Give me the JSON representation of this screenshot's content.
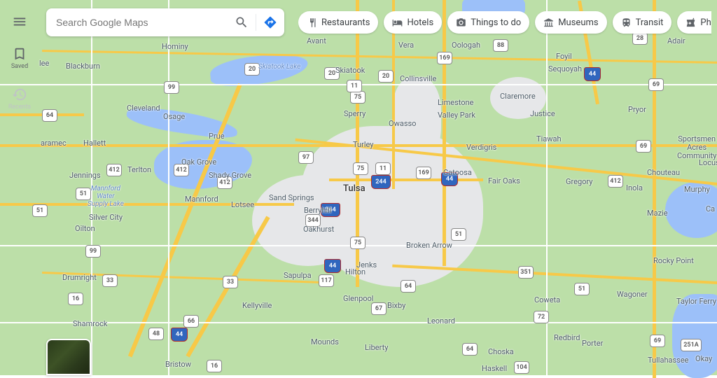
{
  "search": {
    "placeholder": "Search Google Maps"
  },
  "sidebar": {
    "saved": "Saved",
    "recents": "Recents"
  },
  "chips": [
    {
      "label": "Restaurants"
    },
    {
      "label": "Hotels"
    },
    {
      "label": "Things to do"
    },
    {
      "label": "Museums"
    },
    {
      "label": "Transit"
    },
    {
      "label": "Pharmacies"
    }
  ],
  "cities": {
    "tulsa": "Tulsa",
    "sand_springs": "Sand Springs",
    "owasso": "Owasso",
    "broken_arrow": "Broken Arrow",
    "jenks": "Jenks",
    "bixby": "Bixby",
    "sapulpa": "Sapulpa",
    "glenpool": "Glenpool",
    "claremore": "Claremore",
    "collinsville": "Collinsville",
    "skiatook": "Skiatook",
    "coweta": "Coweta",
    "catoosa": "Catoosa",
    "sperry": "Sperry",
    "turley": "Turley",
    "verdigris": "Verdigris",
    "pryor": "Pryor",
    "wagoner": "Wagoner",
    "inola": "Inola",
    "mannford": "Mannford",
    "cleveland": "Cleveland",
    "hominy": "Hominy",
    "bristow": "Bristow",
    "mounds": "Mounds",
    "oologah": "Oologah",
    "sequoyah": "Sequoyah",
    "justice": "Justice",
    "tiawah": "Tiawah",
    "fair_oaks": "Fair Oaks",
    "gregory": "Gregory",
    "chouteau": "Chouteau",
    "mazie": "Mazie",
    "murphy": "Murphy",
    "locust": "Locust",
    "rocky_point": "Rocky Point",
    "taylor_ferry": "Taylor Ferry",
    "tullahassee": "Tullahassee",
    "okay": "Okay",
    "porter": "Porter",
    "redbird": "Redbird",
    "choska": "Choska",
    "haskell": "Haskell",
    "leonard": "Leonard",
    "liberty": "Liberty",
    "kellyville": "Kellyville",
    "shamrock": "Shamrock",
    "drumright": "Drumright",
    "oilton": "Oilton",
    "jennings": "Jennings",
    "hallett": "Hallett",
    "terlton": "Terlton",
    "osage": "Osage",
    "oak_grove": "Oak Grove",
    "shady_grove": "Shady Grove",
    "lotsee": "Lotsee",
    "prue": "Prue",
    "silver_city": "Silver City",
    "blackburn": "Blackburn",
    "avant": "Avant",
    "vera": "Vera",
    "limestone": "Limestone",
    "valley_park": "Valley Park",
    "berryhill": "Berryhill",
    "oakhurst": "Oakhurst",
    "hilton": "Hilton",
    "aramec": "aramec",
    "lee": "lee",
    "ca": "Ca",
    "foyil": "Foyil",
    "adair": "Adair",
    "sportsmen": "Sportsmen\nAcres\nCommunity"
  },
  "lakes": {
    "skiatook": "Skiatook Lake",
    "mannford": "Mannford\nWater\nSupply Lake"
  },
  "highways": {
    "i44": "44",
    "i244": "244",
    "us75": "75",
    "us169": "169",
    "us412": "412",
    "us64": "64",
    "us69": "69",
    "sh51": "51",
    "sh20": "20",
    "sh97": "97",
    "sh11": "11",
    "sh16": "16",
    "sh88": "88",
    "sh99": "99",
    "sh48": "48",
    "sh33": "33",
    "sh66": "66",
    "sh67": "67",
    "sh72": "72",
    "sh117": "117",
    "sh104": "104",
    "sh344": "344",
    "sh351": "351",
    "sh251a": "251A",
    "sh28": "28"
  }
}
